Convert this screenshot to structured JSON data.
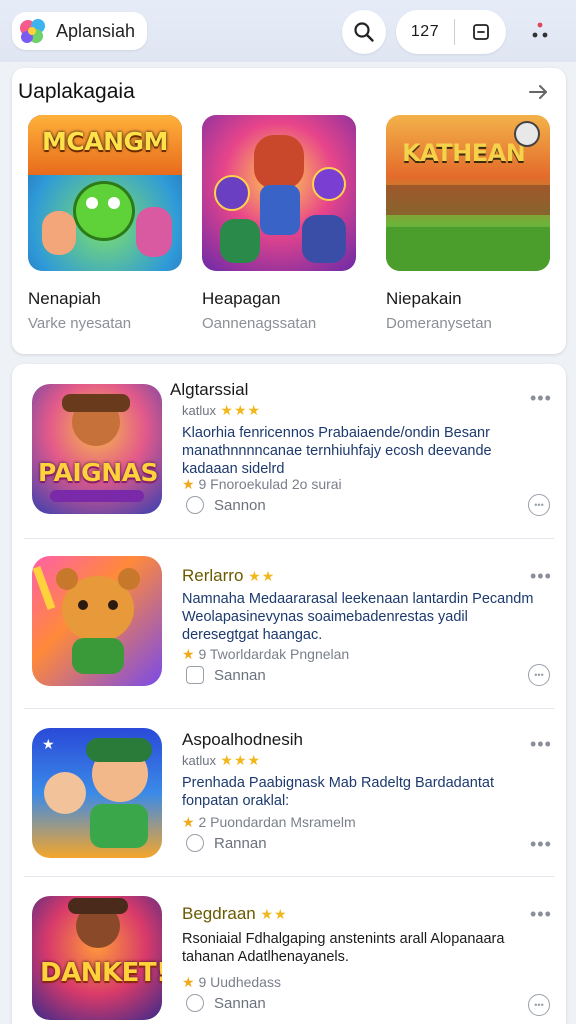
{
  "header": {
    "app_name": "Aplansiah",
    "counter": "127",
    "colors": {
      "bar": "#dfe6f2",
      "accent": "#f2b71c"
    }
  },
  "featured": {
    "title": "Uaplakagaia",
    "items": [
      {
        "title": "Nenapiah",
        "subtitle": "Varke nyesatan",
        "art_text": "MCANGM"
      },
      {
        "title": "Heapagan",
        "subtitle": "Oannenagssatan",
        "art_text": ""
      },
      {
        "title": "Niepakain",
        "subtitle": "Domeranysetan",
        "art_text": "KATHEAN"
      }
    ]
  },
  "list": [
    {
      "title": "Algtarssial",
      "meta": "katlux",
      "stars": "★★★",
      "desc": "Klaorhia fenricennos Prabaiaende/ondin Besanr manathnnnncanae ternhiuhfajy ecosh deevande kadaaan sidelrd",
      "info_rating": "9",
      "info_text": "Fnoroekulad 2o surai",
      "action": "Sannon",
      "art_text": "PAIGNAS"
    },
    {
      "title": "Rerlarro",
      "meta": "",
      "stars": "★★",
      "desc": "Namnaha Medaararasal leekenaan lantardin Pecandm Weolapasinevynas soaimebadenrestas yadil deresegtgat haangac.",
      "info_rating": "9",
      "info_text": "Tworldardak Pngnelan",
      "action": "Sannan",
      "art_text": ""
    },
    {
      "title": "Aspoalhodnesih",
      "meta": "katlux",
      "stars": "★★★",
      "desc": "Prenhada Paabignask Mab Radeltg Bardadantat fonpatan oraklal:",
      "info_rating": "2",
      "info_text": "Puondardan Msramelm",
      "action": "Rannan",
      "art_text": ""
    },
    {
      "title": "Begdraan",
      "meta": "",
      "stars": "★★",
      "desc": "Rsoniaial Fdhalgaping anstenints arall Alopanaara tahanan Adatlhenayanels.",
      "info_rating": "9",
      "info_text": "Uudhedass",
      "action": "Sannan",
      "art_text": "DANKET!"
    }
  ]
}
